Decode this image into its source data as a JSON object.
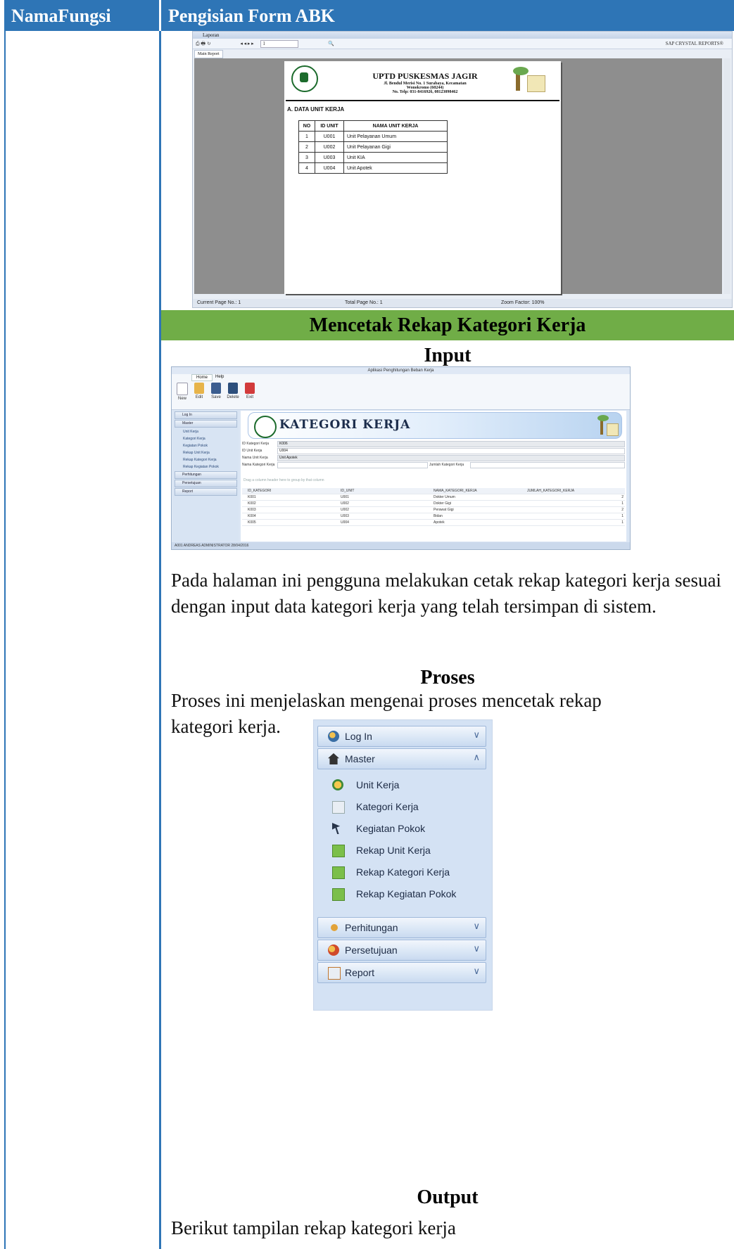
{
  "table": {
    "col1_header": "NamaFungsi",
    "col2_header": "Pengisian Form ABK"
  },
  "report_viewer": {
    "window_title": "Laporan",
    "toolbar_page": "1",
    "toolbar_brand": "SAP CRYSTAL REPORTS®",
    "tab_label": "Main Report",
    "report_header": {
      "org_name": "UPTD PUSKESMAS JAGIR",
      "address": "Jl. Bendul Merisi No. 1 Surabaya, Kecamatan",
      "city": "Wonokromo (60244)",
      "phone": "No. Telp: 031-8416926, 08123098462"
    },
    "section_title": "A. DATA UNIT KERJA",
    "columns": [
      "NO",
      "ID UNIT",
      "NAMA UNIT KERJA"
    ],
    "rows": [
      [
        "1",
        "U001",
        "Unit Pelayanan Umum"
      ],
      [
        "2",
        "U002",
        "Unit Pelayanan Gigi"
      ],
      [
        "3",
        "U003",
        "Unit KIA"
      ],
      [
        "4",
        "U004",
        "Unit Apotek"
      ]
    ],
    "status_current": "Current Page No.: 1",
    "status_total": "Total Page No.: 1",
    "status_zoom": "Zoom Factor: 100%"
  },
  "section": {
    "band_title": "Mencetak Rekap Kategori Kerja",
    "input_heading": "Input",
    "input_paragraph": "Pada halaman ini pengguna melakukan cetak rekap kategori kerja sesuai dengan input data kategori kerja yang telah tersimpan di sistem.",
    "proses_heading": "Proses",
    "proses_paragraph": "Proses ini menjelaskan mengenai proses mencetak rekap kategori kerja.",
    "output_heading": "Output",
    "output_paragraph": "Berikut tampilan rekap kategori kerja"
  },
  "app": {
    "window_title": "Aplikasi Penghitungan Beban Kerja",
    "tabs": [
      "Home",
      "Help"
    ],
    "buttons": [
      "New",
      "Edit",
      "Save",
      "Delete",
      "Exit"
    ],
    "groups": [
      "New",
      "Edit",
      "D...",
      "D...",
      "Exit"
    ],
    "nav": {
      "login": "Log In",
      "master": "Master",
      "items": [
        "Unit Kerja",
        "Kategori Kerja",
        "Kegiatan Pokok",
        "Rekap Unit Kerja",
        "Rekap Kategori Kerja",
        "Rekap Kegiatan Pokok"
      ],
      "perhitungan": "Perhitungan",
      "persetujuan": "Persetujuan",
      "report": "Report"
    },
    "banner_title": "KATEGORI KERJA",
    "form": {
      "id_kategori_label": "ID Kategori Kerja",
      "id_kategori_value": "K006",
      "id_unit_label": "ID Unit Kerja",
      "id_unit_value": "U004",
      "nama_unit_label": "Nama Unit Kerja",
      "nama_unit_value": "Unit Apotek",
      "nama_kategori_label": "Nama Kategori Kerja",
      "nama_kategori_value": "",
      "jumlah_label": "Jumlah Kategori Kerja"
    },
    "grid_hint": "Drag a column header here to group by that column",
    "grid_columns": [
      "ID_KATEGORI",
      "ID_UNIT",
      "NAMA_KATEGORI_KERJA",
      "JUMLAH_KATEGORI_KERJA"
    ],
    "grid_rows": [
      [
        "K001",
        "U001",
        "Dokter Umum",
        "2"
      ],
      [
        "K002",
        "U002",
        "Dokter Gigi",
        "1"
      ],
      [
        "K003",
        "U002",
        "Perawat Gigi",
        "2"
      ],
      [
        "K004",
        "U003",
        "Bidan",
        "1"
      ],
      [
        "K005",
        "U004",
        "Apotek",
        "1"
      ]
    ],
    "status_bar": "A001  ANDREAS  ADMINISTRATOR  28/04/2016"
  },
  "nav_panel": {
    "login": "Log In",
    "master": "Master",
    "items": [
      "Unit Kerja",
      "Kategori Kerja",
      "Kegiatan Pokok",
      "Rekap Unit Kerja",
      "Rekap Kategori Kerja",
      "Rekap Kegiatan Pokok"
    ],
    "perhitungan": "Perhitungan",
    "persetujuan": "Persetujuan",
    "report": "Report"
  }
}
